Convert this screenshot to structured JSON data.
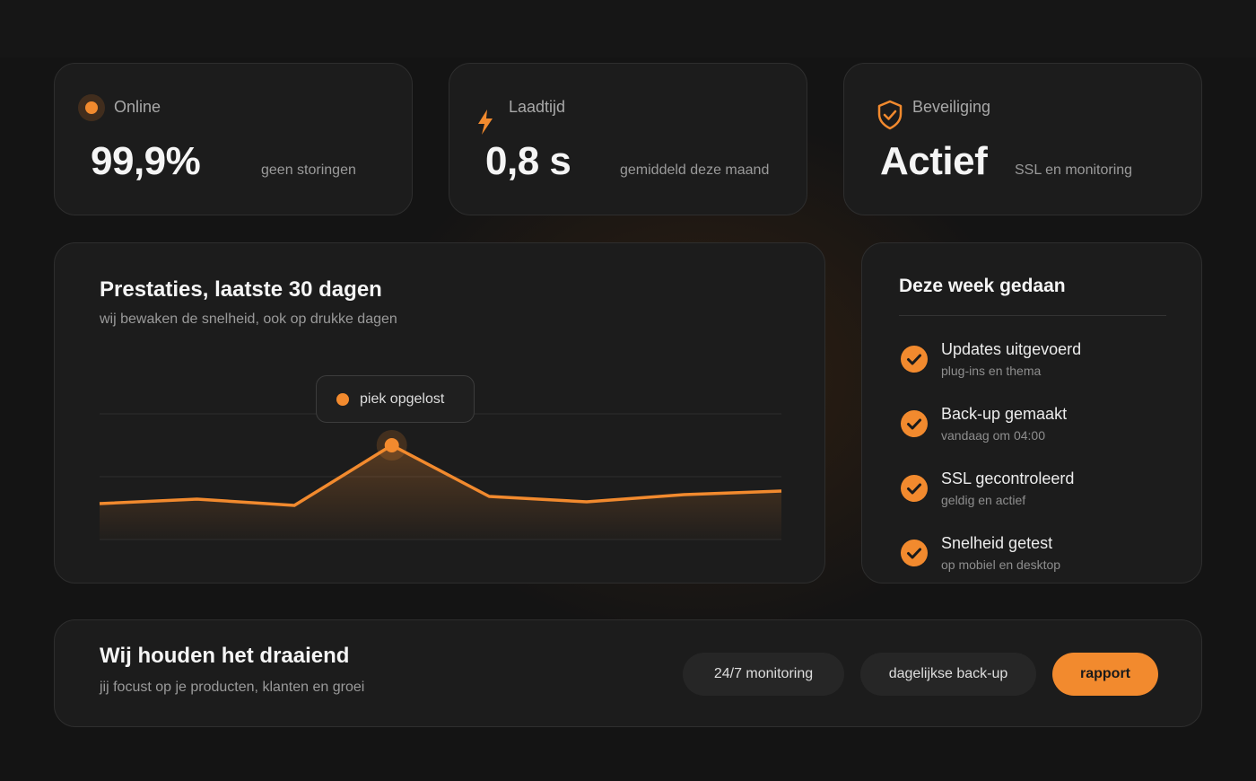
{
  "stats": {
    "online": {
      "label": "Online",
      "value": "99,9%",
      "note": "geen storingen"
    },
    "load": {
      "label": "Laadtijd",
      "value": "0,8 s",
      "note": "gemiddeld deze maand"
    },
    "security": {
      "label": "Beveiliging",
      "value": "Actief",
      "note": "SSL en monitoring"
    }
  },
  "performance": {
    "title": "Prestaties, laatste 30 dagen",
    "subtitle": "wij bewaken de snelheid, ook op drukke dagen",
    "peak_label": "piek opgelost"
  },
  "chart_data": {
    "type": "area",
    "values": [
      40,
      45,
      38,
      105,
      48,
      42,
      50,
      54
    ],
    "peak_index": 3,
    "ylim": [
      0,
      140
    ],
    "grid": true,
    "title": "",
    "xlabel": "",
    "ylabel": ""
  },
  "week": {
    "title": "Deze week gedaan",
    "items": [
      {
        "title": "Updates uitgevoerd",
        "sub": "plug-ins en thema"
      },
      {
        "title": "Back-up gemaakt",
        "sub": "vandaag om 04:00"
      },
      {
        "title": "SSL gecontroleerd",
        "sub": "geldig en actief"
      },
      {
        "title": "Snelheid getest",
        "sub": "op mobiel en desktop"
      }
    ]
  },
  "footer": {
    "title": "Wij houden het draaiend",
    "subtitle": "jij focust op je producten, klanten en groei",
    "pill_monitoring": "24/7 monitoring",
    "pill_backup": "dagelijkse back-up",
    "report_button": "rapport"
  },
  "colors": {
    "accent": "#f28a2e",
    "card": "#1c1c1c",
    "background": "#141414"
  },
  "icons": {
    "online": "status-dot-icon",
    "load": "lightning-icon",
    "security": "shield-check-icon",
    "task": "check-circle-icon"
  }
}
